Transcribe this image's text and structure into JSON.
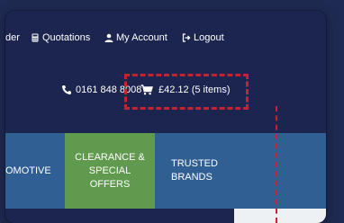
{
  "topnav": {
    "order_partial": "der",
    "quotations": "Quotations",
    "my_account": "My Account",
    "logout": "Logout"
  },
  "header": {
    "phone": "0161 848 8008",
    "cart": "£42.12 (5 items)"
  },
  "categories": [
    {
      "label": "OMOTIVE"
    },
    {
      "label": "CLEARANCE & SPECIAL OFFERS"
    },
    {
      "label": "TRUSTED BRANDS"
    }
  ],
  "colors": {
    "navy": "#1c2550",
    "category_blue": "#2f5f93",
    "clearance_green": "#5f9a4f",
    "highlight_red": "#c4232f"
  },
  "icons": {
    "quotations": "calculator-icon",
    "my_account": "user-icon",
    "logout": "logout-icon",
    "phone": "phone-icon",
    "cart": "shopping-cart-icon"
  }
}
